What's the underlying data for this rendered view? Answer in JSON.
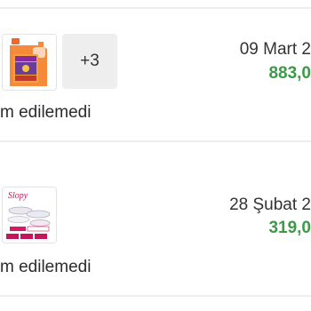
{
  "colors": {
    "price": "#3d9a48",
    "divider": "#eeeeee",
    "more_box": "#eeeeee"
  },
  "orders": [
    {
      "product_image": "orange-detergent-can-image",
      "more_count": "+3",
      "date": "09 Mart 2",
      "price": "883,0",
      "status": "m edilemedi"
    },
    {
      "product_image": "slipper-set-box-image",
      "product_brand": "Slopy",
      "date": "28 Şubat 2",
      "price": "319,0",
      "status": "m edilemedi"
    }
  ]
}
